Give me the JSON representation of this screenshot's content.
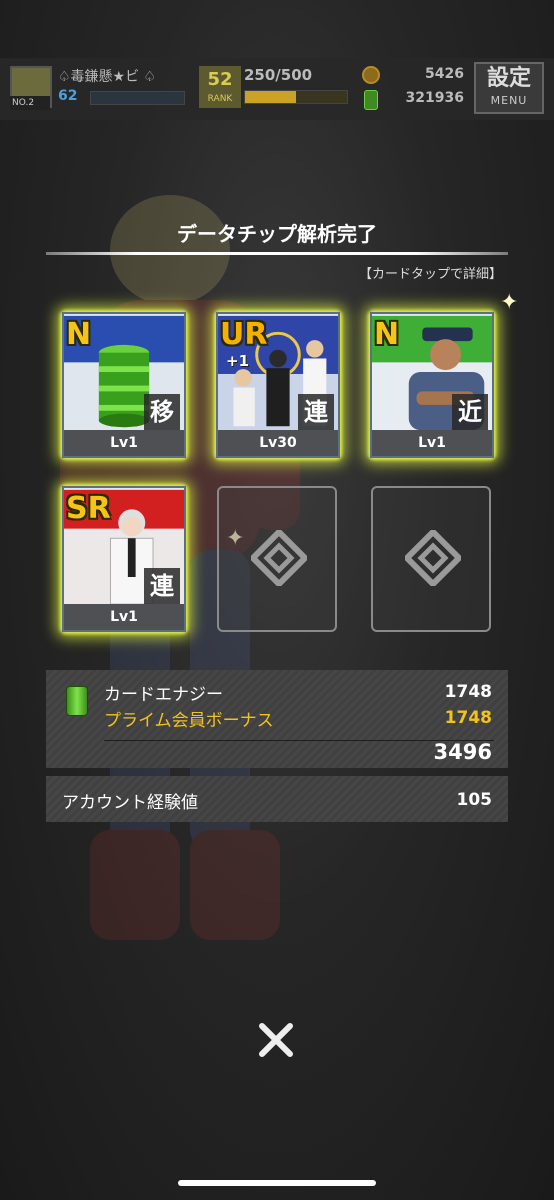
{
  "topbar": {
    "player_name": "♤毒鎌懸★ビ ♤",
    "player_level": "62",
    "avatar_label": "NO.2",
    "xp_fraction": 0.0,
    "rank_value": "52",
    "rank_label": "RANK",
    "stamina": "250/500",
    "stamina_fraction": 0.5,
    "coins": "5426",
    "card_energy": "321936",
    "menu_kanji": "設定",
    "menu_label": "MENU"
  },
  "dialog": {
    "title": "データチップ解析完了",
    "hint": "【カードタップで詳細】"
  },
  "cards": [
    {
      "rarity": "N",
      "type": "移",
      "level": "Lv1",
      "art": "energy-barrel"
    },
    {
      "rarity": "UR",
      "plus": "+1",
      "type": "連",
      "level": "Lv30",
      "art": "group-portrait"
    },
    {
      "rarity": "N",
      "type": "近",
      "level": "Lv1",
      "art": "police-officer"
    },
    {
      "rarity": "SR",
      "type": "連",
      "level": "Lv1",
      "art": "white-suit-man"
    }
  ],
  "energy": {
    "label": "カードエナジー",
    "value": "1748",
    "bonus_label": "プライム会員ボーナス",
    "bonus_value": "1748",
    "total": "3496"
  },
  "exp": {
    "label": "アカウント経験値",
    "value": "105"
  },
  "colors": {
    "card_glow": "#d7eb3c",
    "bonus_text": "#f2c31c",
    "energy_icon": "#7ee34b"
  }
}
